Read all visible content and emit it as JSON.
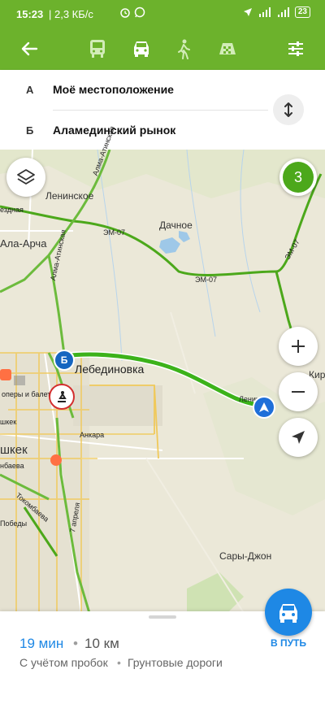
{
  "status": {
    "time": "15:23",
    "speed": "| 2,3 КБ/с",
    "battery": "23"
  },
  "modes": {
    "back_icon": "arrow-left-icon",
    "bus_icon": "bus-icon",
    "car_icon": "car-icon",
    "walk_icon": "pedestrian-icon",
    "taxi_icon": "taxi-icon",
    "settings_icon": "sliders-icon"
  },
  "route": {
    "from_letter": "А",
    "from_label": "Моё местоположение",
    "to_letter": "Б",
    "to_label": "Аламединский рынок"
  },
  "map": {
    "traffic_level": "3",
    "labels": {
      "leninskoe": "Ленинское",
      "dachnoe": "Дачное",
      "ala_archa": "Ала-Арча",
      "lebedinovka": "Лебединовка",
      "sary_dzhon": "Сары-Джон",
      "ezdnaya": "ездная",
      "em07_a": "ЭМ-07",
      "em07_b": "ЭМ-07",
      "em07_c": "ЭМ-07",
      "alma_atinskaya_a": "Алма-Атинская",
      "alma_atinskaya_b": "Алма-Атинская",
      "ankara": "Анкара",
      "tokombaeva": "Токомбаева",
      "aprelya": "7 апреля",
      "lenina": "Ленина",
      "opery": "оперы и балета",
      "ishkek": "шкек",
      "bishkek_part": "шкек",
      "baeva": "нбаева",
      "pobedy": "Победы",
      "kir": "Кир"
    },
    "marker_b": "Б"
  },
  "summary": {
    "duration": "19 мин",
    "separator": "•",
    "distance": "10 км",
    "traffic_note": "С учётом пробок",
    "road_note": "Грунтовые дороги",
    "go_label": "В ПУТЬ"
  },
  "colors": {
    "brand_green": "#6cb22c",
    "route_blue": "#1e88e5",
    "traffic_green": "#4ca81b"
  }
}
